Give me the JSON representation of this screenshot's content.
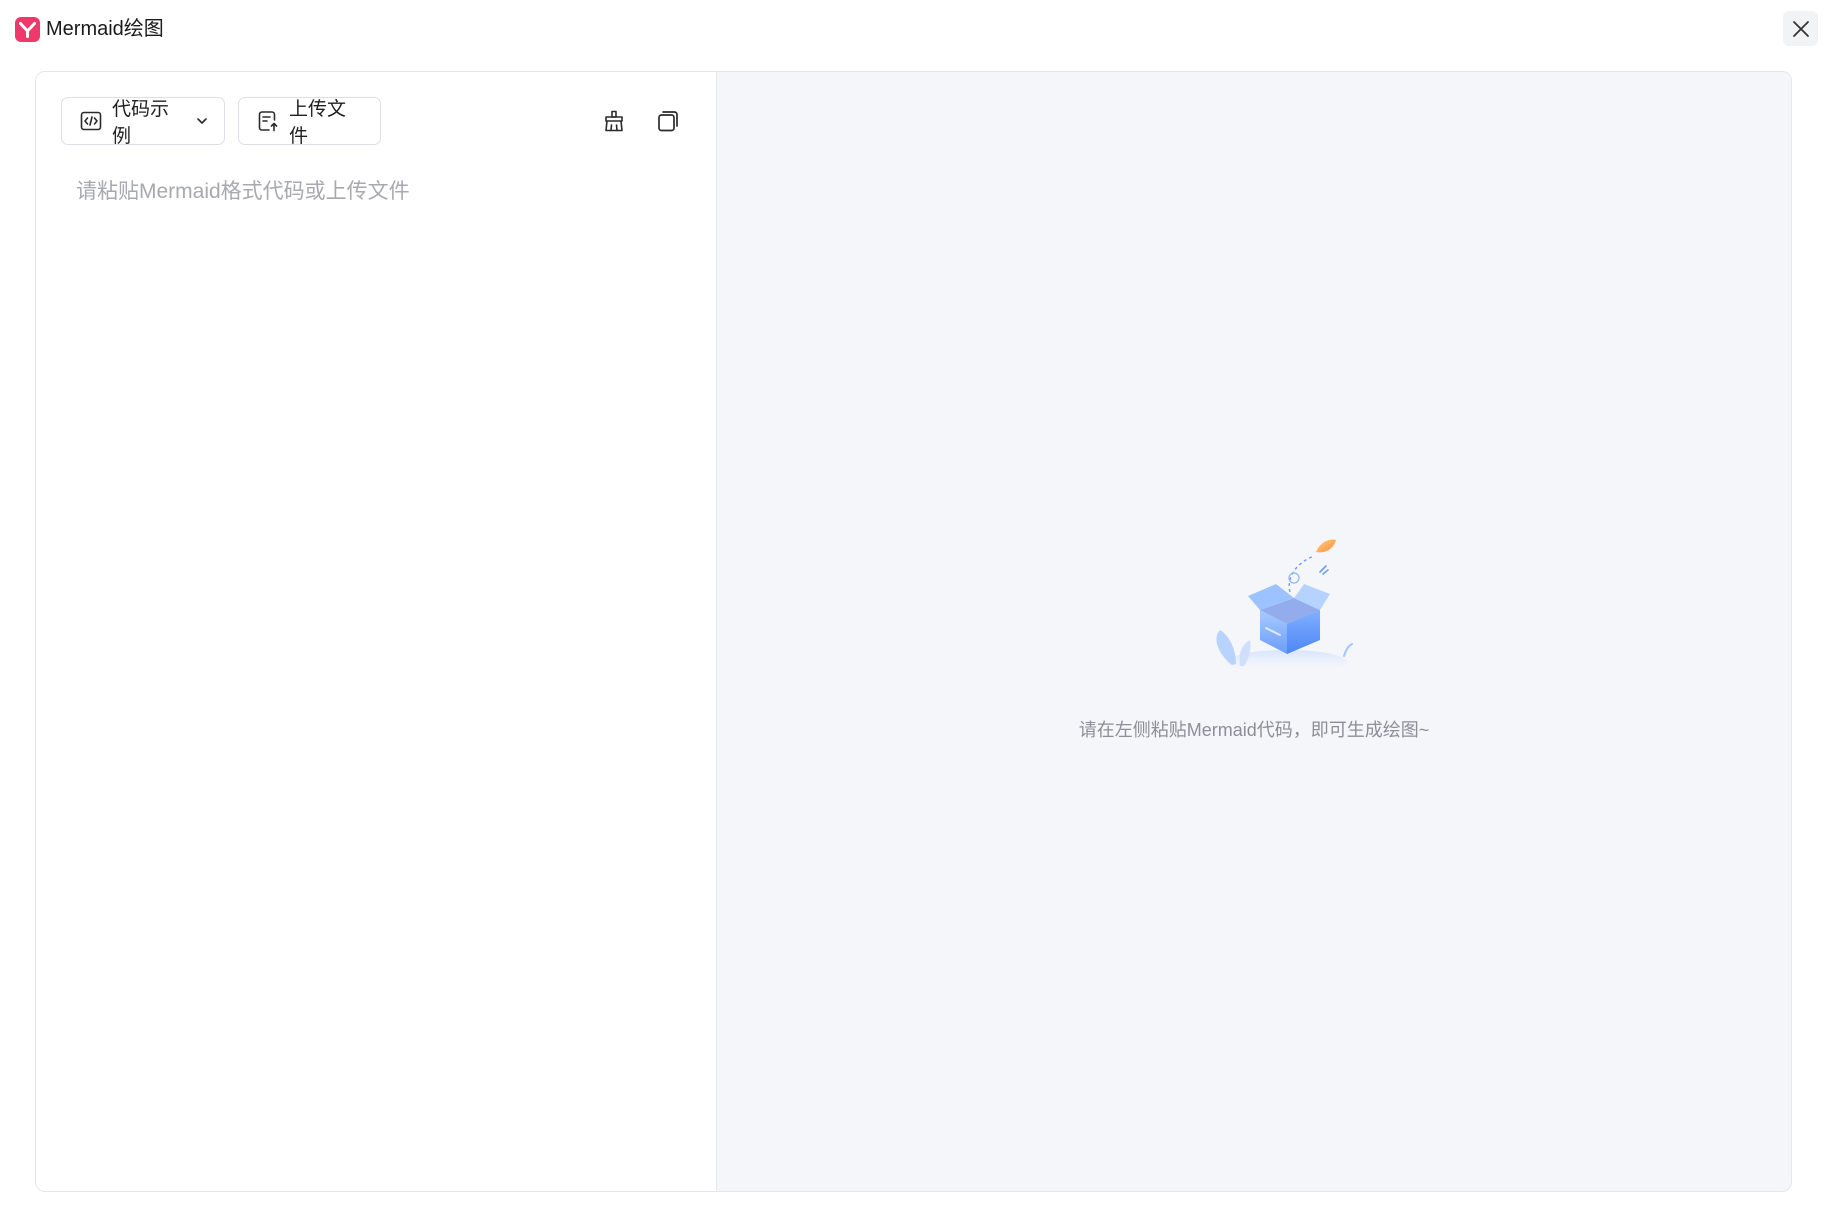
{
  "window": {
    "title": "Mermaid绘图",
    "logo_icon": "mermaid-logo-icon",
    "close_icon": "close-icon",
    "accent_color": "#f0386b"
  },
  "toolbar": {
    "examples_label": "代码示例",
    "upload_label": "上传文件",
    "examples_icon": "code-icon",
    "examples_caret_icon": "chevron-down-icon",
    "upload_icon": "upload-file-icon",
    "clear_icon": "broom-icon",
    "copy_icon": "copy-icon"
  },
  "editor": {
    "value": "",
    "placeholder": "请粘贴Mermaid格式代码或上传文件"
  },
  "preview": {
    "empty_message": "请在左侧粘贴Mermaid代码，即可生成绘图~",
    "empty_illustration": "open-box-illustration"
  }
}
